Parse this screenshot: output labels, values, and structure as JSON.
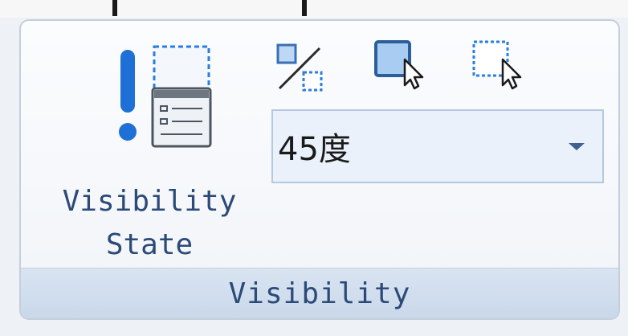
{
  "group": {
    "title": "Visibility"
  },
  "visibility_state_button": {
    "label": "Visibility\nState",
    "icon": "visibility-state-icon"
  },
  "toolbar": {
    "buttons": [
      {
        "icon": "percent-toggle-icon"
      },
      {
        "icon": "select-solid-cursor-icon"
      },
      {
        "icon": "select-dashed-cursor-icon"
      }
    ]
  },
  "angle_combo": {
    "value": "45度"
  },
  "colors": {
    "accent": "#2b4a78",
    "icon_blue": "#1e6fd6",
    "footer": "#cddbed"
  }
}
